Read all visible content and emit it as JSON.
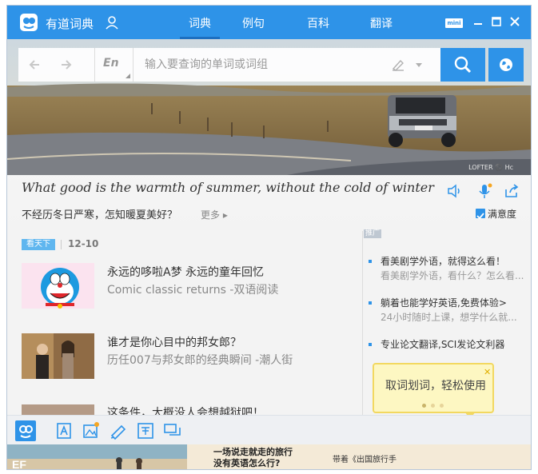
{
  "titlebar": {
    "app_name": "有道词典",
    "tabs": [
      {
        "label": "词典",
        "active": true
      },
      {
        "label": "例句",
        "active": false
      },
      {
        "label": "百科",
        "active": false
      },
      {
        "label": "翻译",
        "active": false
      }
    ],
    "mini_label": "mini"
  },
  "search": {
    "lang": "En",
    "placeholder": "输入要查询的单词或词组"
  },
  "hero": {
    "photo_credit": "LOFTER ©️ Hc"
  },
  "sentence": {
    "english": "What good is the warmth of summer, without the cold of winter to ..",
    "chinese": "不经历冬日严寒，怎知暖夏美好？",
    "more": "更多",
    "satisfaction": "满意度"
  },
  "feed": {
    "tag": "看天下",
    "date": "12-10",
    "items": [
      {
        "title": "永远的哆啦A梦 永远的童年回忆",
        "subtitle": "Comic classic returns -双语阅读"
      },
      {
        "title": "谁才是你心目中的邦女郎？",
        "subtitle": "历任007与邦女郎的经典瞬间 -潮人街"
      },
      {
        "title": "这条件，大概没人会想越狱吧！",
        "subtitle": ""
      }
    ]
  },
  "ads": {
    "tag": "推广",
    "items": [
      {
        "title": "看美剧学外语，就得这么看！",
        "subtitle": "看美剧学外语，看什么？怎么看..."
      },
      {
        "title": "躺着也能学好英语,免费体验>",
        "subtitle": "24小时随时上课，想学什么就..."
      },
      {
        "title": "专业论文翻译,SCI发论文利器",
        "subtitle": ""
      }
    ]
  },
  "tooltip": {
    "text": "取词划词，轻松使用",
    "close": "✕"
  },
  "banner": {
    "line1": "一场说走就走的旅行",
    "line2": "没有英语怎么行?",
    "side": "带着《出国旅行手"
  },
  "colors": {
    "brand_blue": "#2e93e8",
    "tooltip_bg": "#fdf7c2"
  }
}
